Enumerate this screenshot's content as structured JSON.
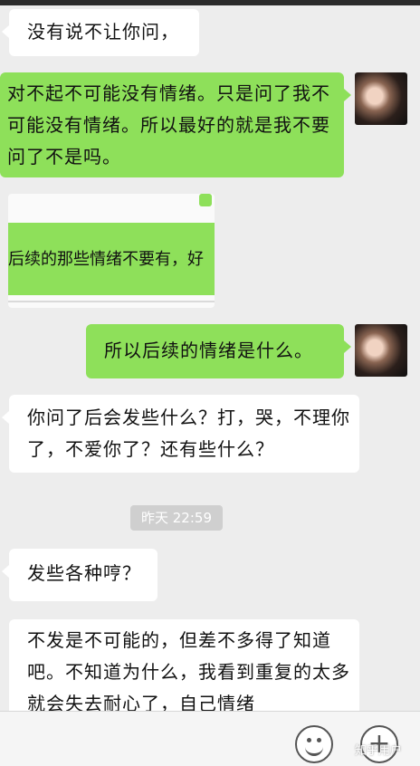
{
  "messages": [
    {
      "side": "left",
      "text": "没有说不让你问，"
    },
    {
      "side": "right",
      "text": "对不起不可能没有情绪。只是问了我不可能没有情绪。所以最好的就是我不要问了不是吗。"
    },
    {
      "side": "right",
      "text": "所以后续的情绪是什么。"
    },
    {
      "side": "left",
      "text": "你问了后会发些什么？打，哭，不理你了，不爱你了？还有些什么？"
    },
    {
      "side": "left",
      "text": "发些各种哼？"
    },
    {
      "side": "left",
      "text": "不发是不可能的，但差不多得了知道吧。不知道为什么，我看到重复的太多就会失去耐心了，自己情绪"
    }
  ],
  "quote": {
    "text": "后续的那些情绪不要有，好"
  },
  "timestamp": "昨天 22:59",
  "watermark": "知乎用户",
  "icons": {
    "emoji": "smiley-icon",
    "plus": "plus-icon"
  },
  "plus_symbol": "+",
  "colors": {
    "background": "#ededed",
    "outgoing": "#8ee05a",
    "incoming": "#ffffff"
  }
}
